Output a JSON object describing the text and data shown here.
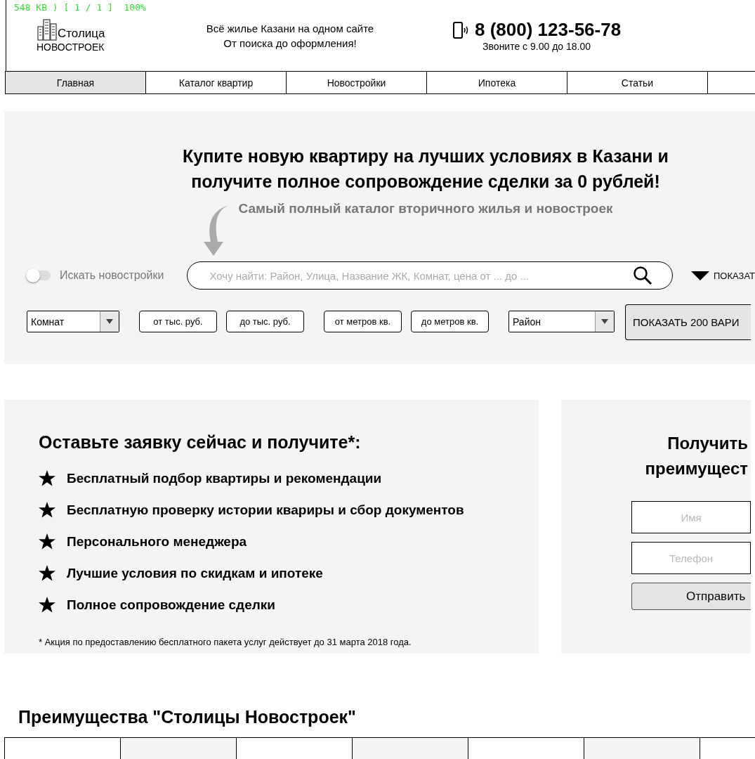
{
  "viewer_status": "548 KB ) [ 1 / 1 ]  100%",
  "header": {
    "logo_top": "Столица",
    "logo_bottom": "НОВОСТРОЕК",
    "tagline": [
      "Всё жилье Казани на одном сайте",
      "От поиска до оформления!"
    ],
    "phone": "8 (800) 123-56-78",
    "hours": "Звоните с 9.00 до 18.00"
  },
  "nav": [
    {
      "label": "Главная",
      "selected": true
    },
    {
      "label": "Каталог квартир",
      "selected": false
    },
    {
      "label": "Новостройки",
      "selected": false
    },
    {
      "label": "Ипотека",
      "selected": false
    },
    {
      "label": "Статьи",
      "selected": false
    }
  ],
  "hero": {
    "title_lines": [
      "Купите новую квартиру на лучших условиях в Казани и",
      "получите полное сопровождение сделки за 0 рублей!"
    ],
    "subtitle": "Самый полный каталог вторичного жилья и новостроек",
    "toggle": {
      "label": "Искать новостройки",
      "on": false
    },
    "search": {
      "placeholder": "Хочу найти: Район, Улица, Название ЖК, Комнат, цена от ... до ..."
    },
    "more": "ПОКАЗАТ",
    "filter_groups": [
      [
        {
          "kind": "select",
          "label": "Комнат"
        }
      ],
      [
        {
          "kind": "input",
          "placeholder": "от тыс. руб."
        },
        {
          "kind": "input",
          "placeholder": "до тыс. руб."
        }
      ],
      [
        {
          "kind": "input",
          "placeholder": "от метров кв."
        },
        {
          "kind": "input",
          "placeholder": "до метров кв."
        }
      ],
      [
        {
          "kind": "select",
          "label": "Район"
        }
      ]
    ],
    "submit": "ПОКАЗАТЬ 200 ВАРИ"
  },
  "offer": {
    "title": "Оставьте заявку сейчас и получите*:",
    "items": [
      "Бесплатный подбор квартиры и рекомендации",
      "Бесплатную проверку истории квариры и сбор документов",
      "Персонального менеджера",
      "Лучшие условия по скидкам и ипотеке",
      "Полное сопровождение сделки"
    ],
    "footnote": "* Акция по предоставлению бесплатного пакета услуг действует до 31 марта 2018 года."
  },
  "form": {
    "title_lines": [
      "Получить",
      "преимущест"
    ],
    "fields": [
      {
        "placeholder": "Имя"
      },
      {
        "placeholder": "Телефон"
      }
    ],
    "button": "Отправить"
  },
  "advantages": {
    "title": "Преимущества \"Столицы Новостроек\""
  }
}
